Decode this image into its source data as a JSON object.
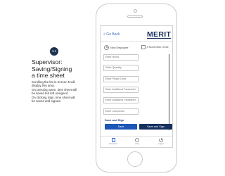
{
  "annotation": {
    "step": "3.1",
    "title_line1": "Supervisor:",
    "title_line2": "Saving/Signing",
    "title_line3": "a time sheet",
    "body": [
      "Scrolling the list in Screen 5 will",
      "display this area.",
      "On pressing save, time sheet will",
      "be saved but left unsigned",
      "On clicking Sign, time sheet will",
      "be saved and signed."
    ]
  },
  "app": {
    "back_label": "< Go Back",
    "logo": "MERIT",
    "employee_label": "New Employee",
    "date_label": "3 November, 2016"
  },
  "form": {
    "fields": [
      {
        "placeholder": "Enter Hours",
        "value": ""
      },
      {
        "placeholder": "Enter Quantity",
        "value": ""
      },
      {
        "placeholder": "Enter Phase Code",
        "value": ""
      },
      {
        "placeholder": "Enter Additional Parameter 1",
        "value": ""
      },
      {
        "placeholder": "Enter Additional Parameter 2",
        "value": ""
      },
      {
        "placeholder": "Enter Comments",
        "value": ""
      }
    ],
    "section_label": "Save and Sign",
    "save_label": "Save",
    "sign_label": "Save and Sign"
  },
  "tabs": [
    {
      "label": "Timesheet",
      "icon": "document-icon"
    },
    {
      "label": "Help",
      "icon": "help-icon"
    },
    {
      "label": "Logout",
      "icon": "power-icon"
    }
  ],
  "colors": {
    "primary": "#1d56b6",
    "dark": "#15305e",
    "badge": "#1f3350"
  }
}
